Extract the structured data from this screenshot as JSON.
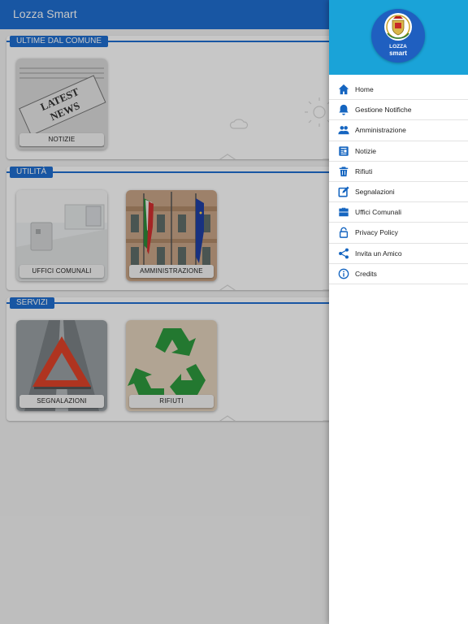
{
  "app": {
    "title": "Lozza Smart"
  },
  "sections": [
    {
      "label": "ULTIME DAL COMUNE",
      "tiles": [
        {
          "caption": "NOTIZIE",
          "image": "latest-news-newspaper"
        }
      ]
    },
    {
      "label": "UTILITÀ",
      "tiles": [
        {
          "caption": "UFFICI COMUNALI",
          "image": "office-desk"
        },
        {
          "caption": "AMMINISTRAZIONE",
          "image": "flags-building"
        }
      ]
    },
    {
      "label": "SERVIZI",
      "tiles": [
        {
          "caption": "SEGNALAZIONI",
          "image": "warning-triangle"
        },
        {
          "caption": "RIFIUTI",
          "image": "recycle-symbol"
        }
      ]
    }
  ],
  "drawer": {
    "logo": {
      "line1": "LOZZA",
      "line2": "smart"
    },
    "items": [
      {
        "label": "Home",
        "icon": "home-icon"
      },
      {
        "label": "Gestione Notifiche",
        "icon": "bell-icon"
      },
      {
        "label": "Amministrazione",
        "icon": "people-icon"
      },
      {
        "label": "Notizie",
        "icon": "newspaper-icon"
      },
      {
        "label": "Rifiuti",
        "icon": "trash-icon"
      },
      {
        "label": "Segnalazioni",
        "icon": "edit-icon"
      },
      {
        "label": "Uffici Comunali",
        "icon": "briefcase-icon"
      },
      {
        "label": "Privacy Policy",
        "icon": "lock-icon"
      },
      {
        "label": "Invita un Amico",
        "icon": "share-icon"
      },
      {
        "label": "Credits",
        "icon": "info-icon"
      }
    ]
  },
  "colors": {
    "appbar": "#1f6fd1",
    "drawer_header": "#1aa3d8",
    "accent": "#1f6fd1",
    "icon": "#1565c0"
  }
}
